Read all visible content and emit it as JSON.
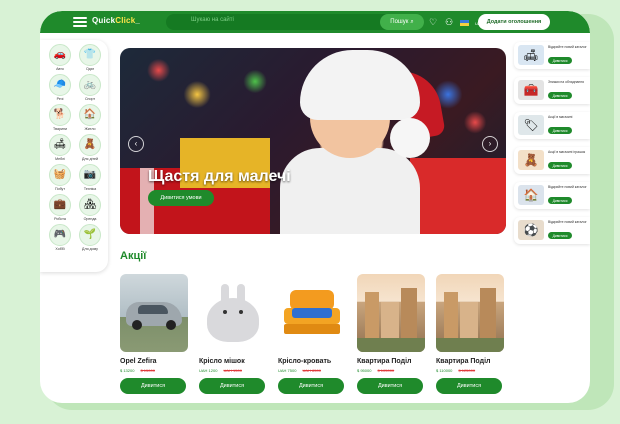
{
  "header": {
    "logo_main": "Quick",
    "logo_accent": "Click",
    "logo_suffix": "_",
    "search_placeholder": "Шукаю на сайті",
    "search_button": "Пошук",
    "lang": "UA",
    "add_button": "Додати оголошення"
  },
  "categories": [
    {
      "label": "Авто",
      "icon": "car-icon",
      "glyph": "🚗"
    },
    {
      "label": "Одяг",
      "icon": "tshirt-icon",
      "glyph": "👕"
    },
    {
      "label": "Речі",
      "icon": "cap-icon",
      "glyph": "🧢"
    },
    {
      "label": "Спорт",
      "icon": "sport-icon",
      "glyph": "🚲"
    },
    {
      "label": "Тварини",
      "icon": "animal-icon",
      "glyph": "🐕"
    },
    {
      "label": "Житло",
      "icon": "housing-icon",
      "glyph": "🏠"
    },
    {
      "label": "Меблі",
      "icon": "furniture-icon",
      "glyph": "🛋"
    },
    {
      "label": "Для дітей",
      "icon": "kids-icon",
      "glyph": "🧸"
    },
    {
      "label": "Побут",
      "icon": "appliance-icon",
      "glyph": "🧺"
    },
    {
      "label": "Техніка",
      "icon": "tech-icon",
      "glyph": "📷"
    },
    {
      "label": "Робота",
      "icon": "work-icon",
      "glyph": "💼"
    },
    {
      "label": "Оренда",
      "icon": "rent-icon",
      "glyph": "🏘"
    },
    {
      "label": "Хоббі",
      "icon": "hobby-icon",
      "glyph": "🎮"
    },
    {
      "label": "Для дому",
      "icon": "garden-icon",
      "glyph": "🌱"
    }
  ],
  "hero": {
    "title": "Щастя для малечі",
    "button": "Дивитися умови"
  },
  "ads": [
    {
      "text": "Відкрийте новий каталог",
      "button": "Дивитися",
      "glyph": "🛋"
    },
    {
      "text": "Знижки на обладнання",
      "button": "Дивитися",
      "glyph": "🧰"
    },
    {
      "text": "Акції в магазині",
      "button": "Дивитися",
      "glyph": "🏷"
    },
    {
      "text": "Акції в магазині іграшок",
      "button": "Дивитися",
      "glyph": "🧸"
    },
    {
      "text": "Відкрийте новий каталог",
      "button": "Дивитися",
      "glyph": "🏠"
    },
    {
      "text": "Відкрийте новий каталог",
      "button": "Дивитися",
      "glyph": "⚽"
    }
  ],
  "promo": {
    "title": "Акції",
    "products": [
      {
        "name": "Opel Zefira",
        "price": "$ 13200",
        "old_price": "$ 15000",
        "button": "Дивитися",
        "image": "car-photo"
      },
      {
        "name": "Крісло мішок",
        "price": "UAH 1200",
        "old_price": "UAH 1500",
        "button": "Дивитися",
        "image": "beanbag-photo"
      },
      {
        "name": "Крісло-кровать",
        "price": "UAH 7500",
        "old_price": "UAH 8500",
        "button": "Дивитися",
        "image": "sofa-photo"
      },
      {
        "name": "Квартира Поділ",
        "price": "$ 95000",
        "old_price": "$ 105000",
        "button": "Дивитися",
        "image": "city-photo"
      },
      {
        "name": "Квартира Поділ",
        "price": "$ 110000",
        "old_price": "$ 125000",
        "button": "Дивитися",
        "image": "city-photo"
      }
    ]
  },
  "colors": {
    "brand_green": "#1f8a2b",
    "accent_yellow": "#ffe34a",
    "price_green": "#1f8a2b",
    "old_price_red": "#e03c3c"
  }
}
